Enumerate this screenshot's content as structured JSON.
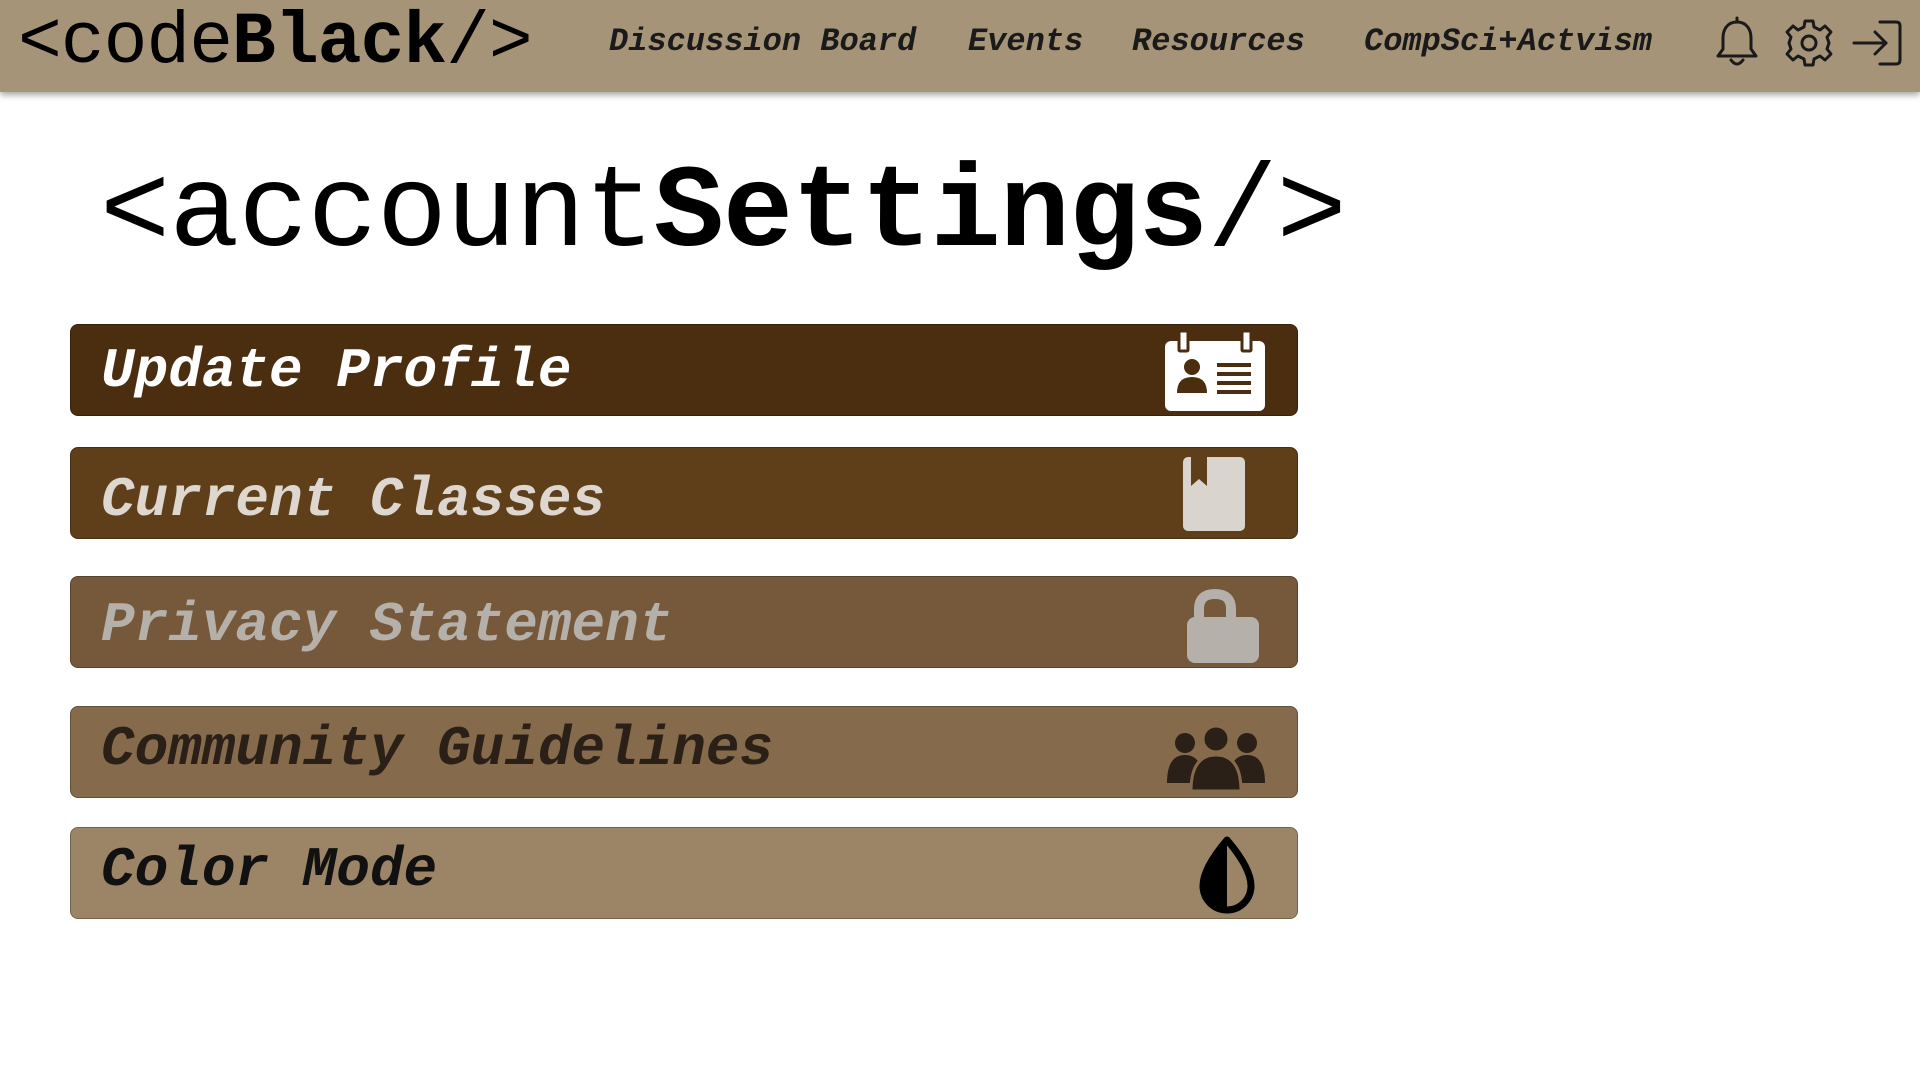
{
  "header": {
    "logo_prefix": "<code",
    "logo_bold": "Black",
    "logo_suffix": "/>",
    "nav": [
      {
        "label": "Discussion Board"
      },
      {
        "label": "Events"
      },
      {
        "label": "Resources"
      },
      {
        "label": "CompSci+Actvism"
      }
    ],
    "icons": [
      "bell-icon",
      "gear-icon",
      "sign-out-icon"
    ]
  },
  "page": {
    "title_prefix": "<account",
    "title_bold": "Settings",
    "title_suffix": "/>"
  },
  "menu": [
    {
      "label": "Update Profile",
      "icon": "id-card-icon",
      "bg": "#4b2e0f",
      "fg": "#ffffff"
    },
    {
      "label": "Current Classes",
      "icon": "book-icon",
      "bg": "#5e3f19",
      "fg": "#ddd7d0"
    },
    {
      "label": "Privacy Statement",
      "icon": "lock-icon",
      "bg": "#75593a",
      "fg": "#b5b0aa"
    },
    {
      "label": "Community Guidelines",
      "icon": "users-icon",
      "bg": "#856b4c",
      "fg": "#2b2017"
    },
    {
      "label": "Color Mode",
      "icon": "contrast-drop-icon",
      "bg": "#9c8566",
      "fg": "#111111"
    }
  ],
  "colors": {
    "topbar": "#a69479",
    "background": "#ffffff"
  }
}
